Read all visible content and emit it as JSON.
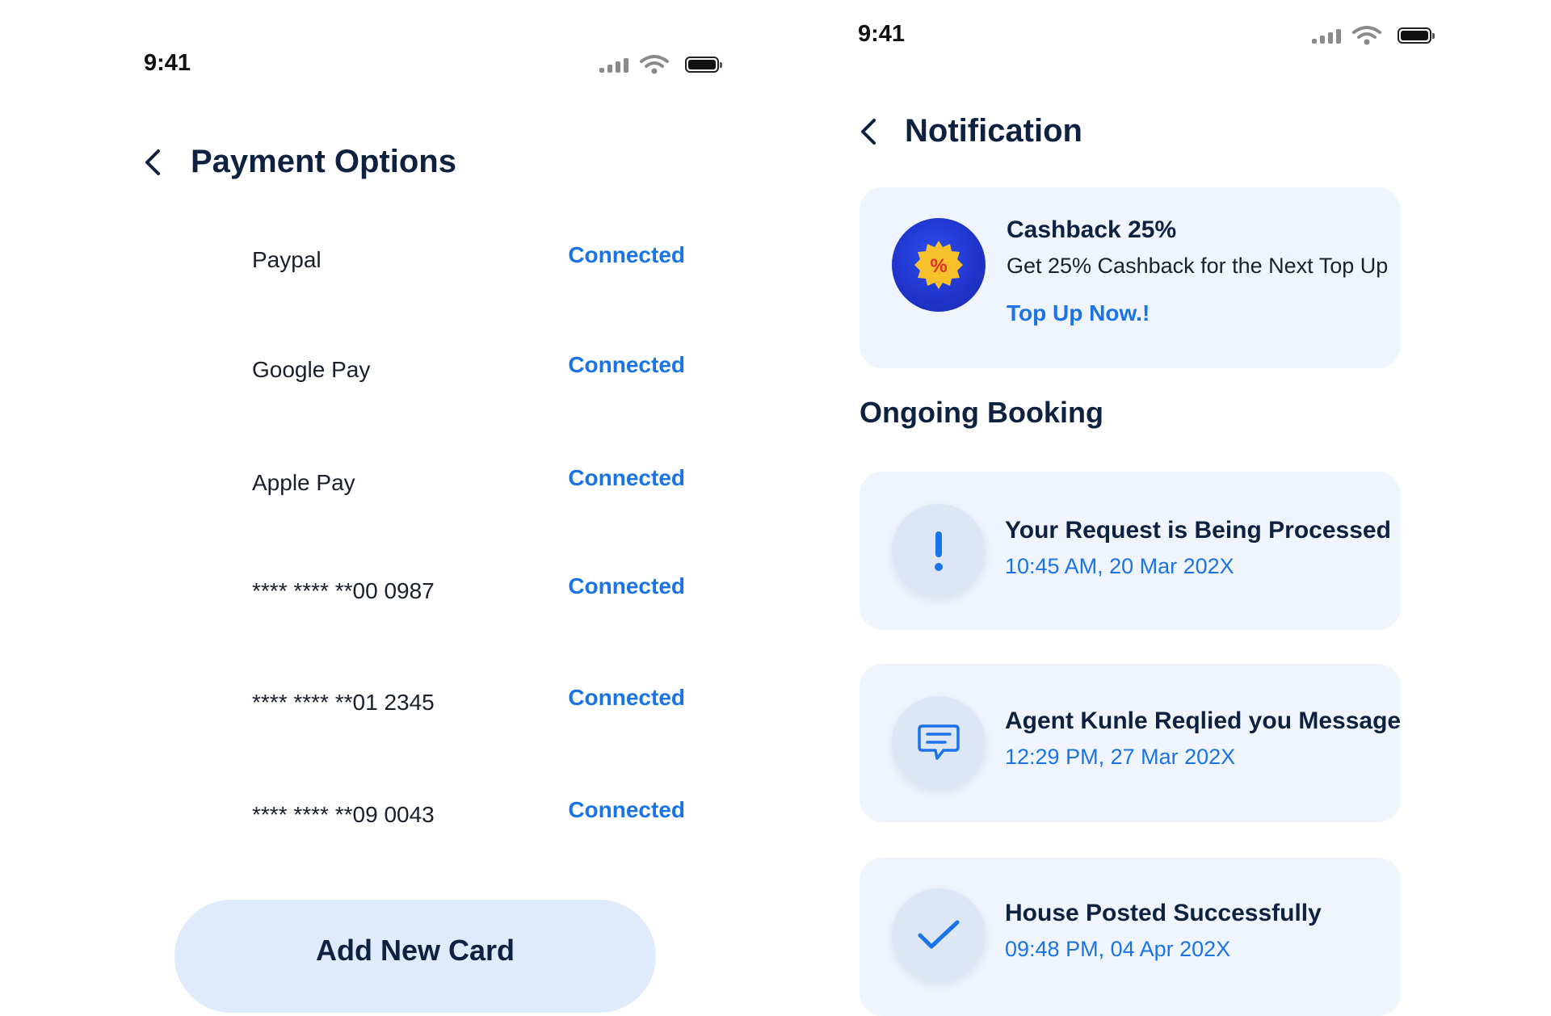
{
  "payment_screen": {
    "status_time": "9:41",
    "title": "Payment Options",
    "items": [
      {
        "name": "Paypal",
        "status": "Connected"
      },
      {
        "name": "Google Pay",
        "status": "Connected"
      },
      {
        "name": "Apple Pay",
        "status": "Connected"
      },
      {
        "name": "**** **** **00 0987",
        "status": "Connected"
      },
      {
        "name": "**** **** **01 2345",
        "status": "Connected"
      },
      {
        "name": "**** **** **09 0043",
        "status": "Connected"
      }
    ],
    "add_button_label": "Add New Card"
  },
  "notification_screen": {
    "status_time": "9:41",
    "title": "Notification",
    "promo": {
      "badge_symbol": "%",
      "title": "Cashback 25%",
      "description": "Get 25% Cashback for the Next Top Up",
      "cta": "Top Up Now.!"
    },
    "section_title": "Ongoing Booking",
    "notifications": [
      {
        "icon": "exclamation-icon",
        "title": "Your Request is Being Processed",
        "time": "10:45 AM, 20 Mar 202X"
      },
      {
        "icon": "chat-message-icon",
        "title": "Agent Kunle Reqlied you Message",
        "time": "12:29 PM, 27 Mar 202X"
      },
      {
        "icon": "checkmark-icon",
        "title": "House Posted Successfully",
        "time": "09:48 PM, 04 Apr 202X"
      }
    ]
  },
  "colors": {
    "accent": "#1a73e8",
    "title": "#0f2140",
    "card_bg": "#f0f5fd",
    "button_bg": "#dfeafb",
    "promo_circle": "#1f33c9",
    "promo_badge": "#f6c12a"
  }
}
